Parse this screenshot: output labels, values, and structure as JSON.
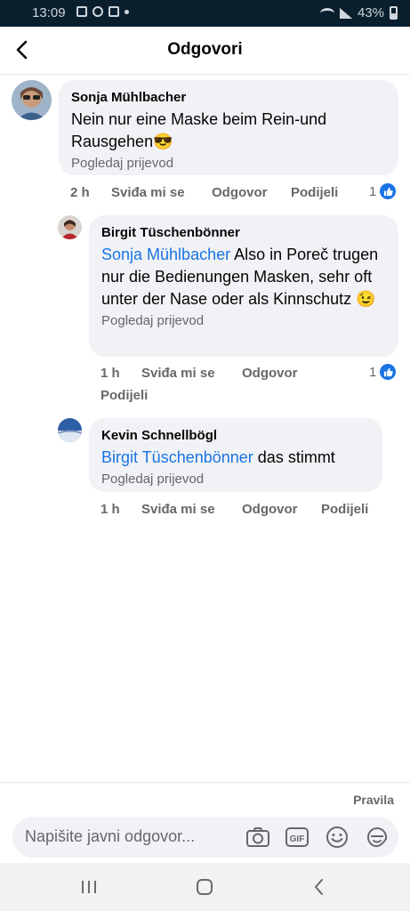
{
  "status_bar": {
    "time": "13:09",
    "battery": "43%"
  },
  "header": {
    "title": "Odgovori",
    "back_icon": "back-arrow-icon"
  },
  "comments": [
    {
      "author": "Sonja Mühlbacher",
      "mention": "",
      "text": "Nein nur eine Maske beim Rein-und Rausgehen😎",
      "translate": "Pogledaj prijevod",
      "time": "2 h",
      "like": "Sviđa mi se",
      "reply": "Odgovor",
      "share": "Podijeli",
      "likes": "1"
    },
    {
      "author": "Birgit Tüschenbönner",
      "mention": "Sonja Mühlbacher",
      "text": "Also in Poreč trugen nur die Bedienungen Masken, sehr oft unter der Nase oder als Kinnschutz 😉",
      "translate": "Pogledaj prijevod",
      "time": "1 h",
      "like": "Sviđa mi se",
      "reply": "Odgovor",
      "share": "Podijeli",
      "likes": "1"
    },
    {
      "author": "Kevin Schnellbögl",
      "mention": "Birgit Tüschenbönner",
      "text": "das stimmt",
      "translate": "Pogledaj prijevod",
      "time": "1 h",
      "like": "Sviđa mi se",
      "reply": "Odgovor",
      "share": "Podijeli",
      "likes": ""
    }
  ],
  "footer": {
    "rules": "Pravila",
    "composer_placeholder": "Napišite javni odgovor...",
    "gif_label": "GIF"
  },
  "colors": {
    "accent": "#1b74e4",
    "bubble": "#f0f2f5",
    "muted": "#65676b"
  }
}
